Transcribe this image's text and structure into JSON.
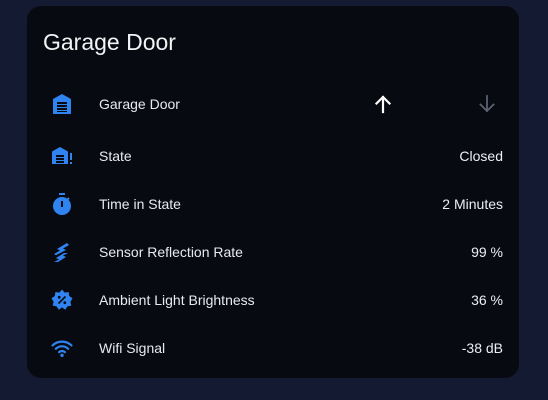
{
  "card": {
    "title": "Garage Door",
    "cover": {
      "label": "Garage Door",
      "icon": "garage-icon",
      "open_button_icon": "arrow-up-icon",
      "close_button_icon": "arrow-down-icon",
      "close_disabled": true
    },
    "entities": [
      {
        "label": "State",
        "value": "Closed",
        "icon": "garage-alert-icon"
      },
      {
        "label": "Time in State",
        "value": "2 Minutes",
        "icon": "timer-icon"
      },
      {
        "label": "Sensor Reflection Rate",
        "value": "99 %",
        "icon": "reflection-sensor-icon"
      },
      {
        "label": "Ambient Light Brightness",
        "value": "36 %",
        "icon": "brightness-percent-icon"
      },
      {
        "label": "Wifi Signal",
        "value": "-38 dB",
        "icon": "wifi-icon"
      }
    ]
  },
  "colors": {
    "page_background": "#131a31",
    "card_background": "#080a11",
    "icon_accent": "#2f84f2",
    "text_primary": "#e8eaee",
    "disabled": "#5a6170"
  }
}
